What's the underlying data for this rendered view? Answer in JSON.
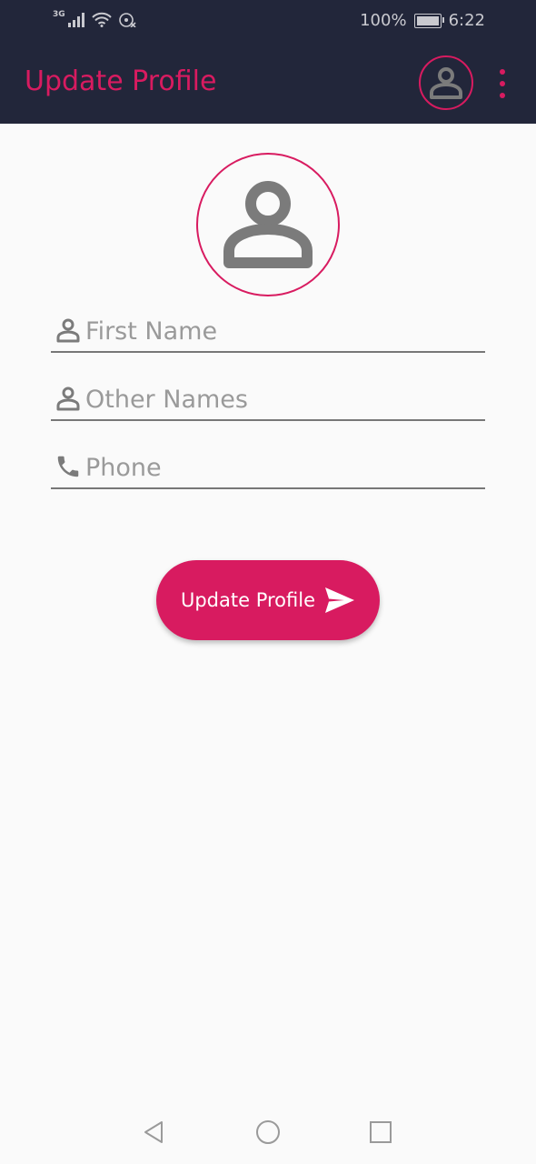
{
  "status_bar": {
    "network": "3G",
    "battery": "100%",
    "time": "6:22"
  },
  "appbar": {
    "title": "Update Profile",
    "avatar_icon": "account-circle-icon",
    "menu_icon": "more-vert-icon"
  },
  "profile": {
    "picture_icon": "person-icon"
  },
  "form": {
    "first_name": {
      "placeholder": "First Name",
      "value": "",
      "icon": "person-icon"
    },
    "other_names": {
      "placeholder": "Other Names",
      "value": "",
      "icon": "person-icon"
    },
    "phone": {
      "placeholder": "Phone",
      "value": "",
      "icon": "phone-icon"
    }
  },
  "submit": {
    "label": "Update Profile",
    "icon": "send-icon"
  },
  "nav": {
    "back_icon": "back-triangle-icon",
    "home_icon": "home-circle-icon",
    "recents_icon": "recents-square-icon"
  },
  "colors": {
    "accent": "#d81b60",
    "appbar_bg": "#22263a",
    "page_bg": "#fafafa",
    "icon_gray": "#7b7b7b"
  }
}
